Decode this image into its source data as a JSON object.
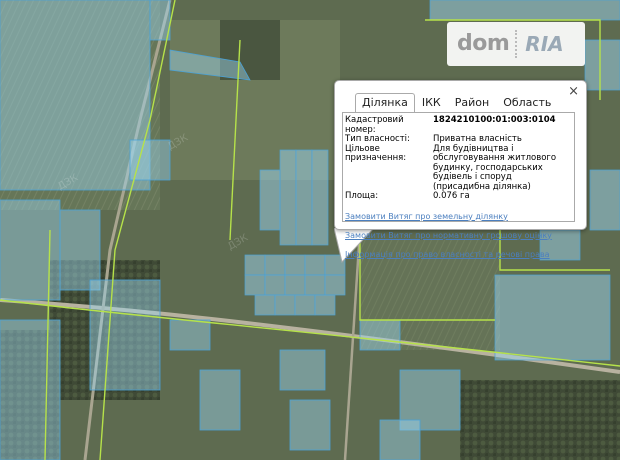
{
  "branding": {
    "logo_left": "dom",
    "logo_right": "RIA"
  },
  "map": {
    "colors": {
      "parcel_fill": "#9cd4ee",
      "parcel_stroke": "#4aa2d6",
      "boundary": "#b6e24a",
      "terrain": "#5e6b50"
    }
  },
  "popup": {
    "close_label": "×",
    "tabs": [
      {
        "label": "Ділянка",
        "active": true
      },
      {
        "label": "ІКК",
        "active": false
      },
      {
        "label": "Район",
        "active": false
      },
      {
        "label": "Область",
        "active": false
      }
    ],
    "fields": [
      {
        "key": "Кадастровий номер:",
        "value": "1824210100:01:003:0104"
      },
      {
        "key": "Тип власності:",
        "value": "Приватна власність"
      },
      {
        "key": "Цільове призначення:",
        "value": "Для будівництва і обслуговування житлового будинку, господарських будівель і споруд (присадибна ділянка)"
      },
      {
        "key": "Площа:",
        "value": "0.076 га"
      }
    ],
    "links": [
      "Замовити Витяг про земельну ділянку",
      "Замовити Витяг про нормативну грошову оцінку",
      "Інформація про право власності та речові права"
    ]
  }
}
